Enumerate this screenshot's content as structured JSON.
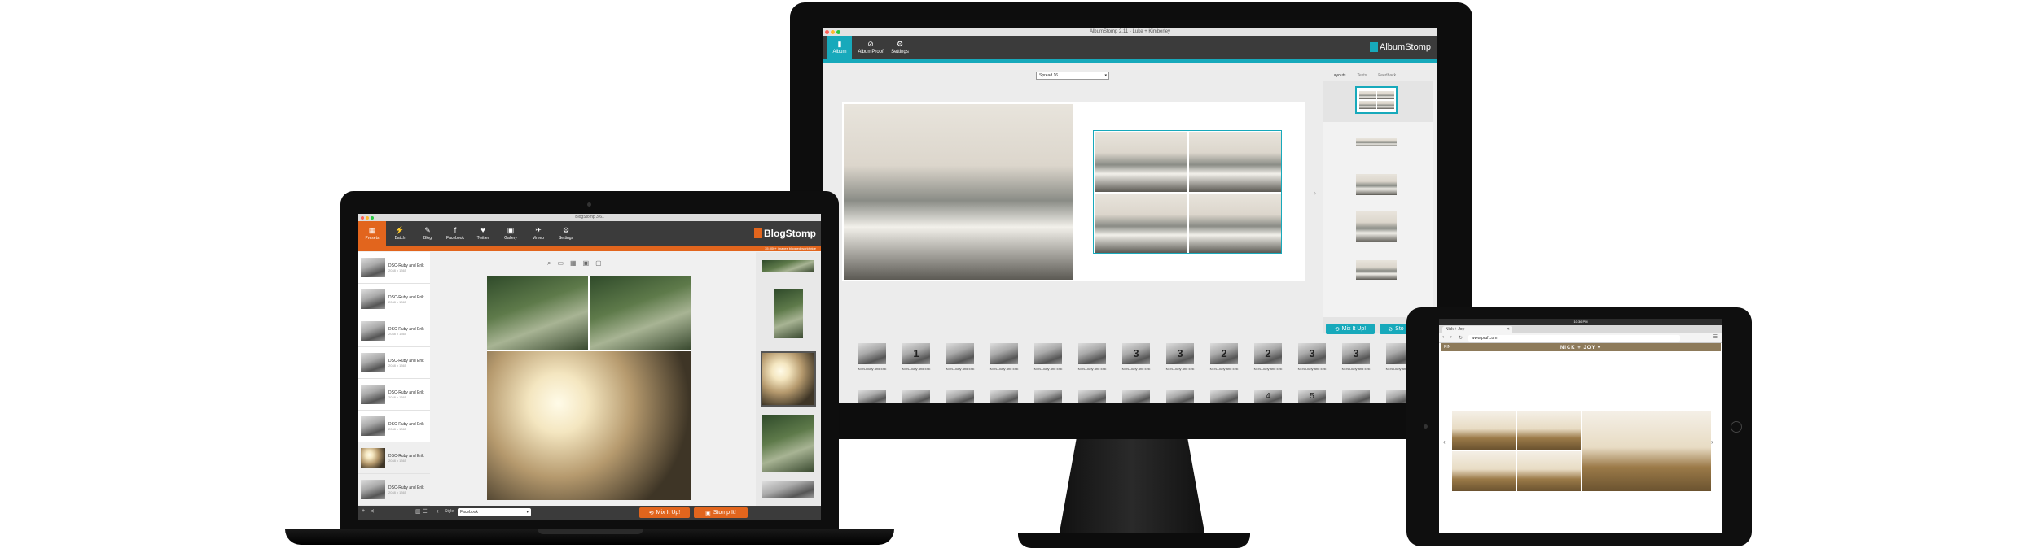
{
  "monitor": {
    "window_title": "AlbumStomp 2.11 - Luke + Kimberley",
    "toolbar": [
      {
        "label": "Album",
        "icon": "album-icon"
      },
      {
        "label": "AlbumProof",
        "icon": "proof-icon"
      },
      {
        "label": "Settings",
        "icon": "gear-icon"
      }
    ],
    "logo_text": "AlbumStomp",
    "spread_select": "Spread 16",
    "tabs": [
      "Layouts",
      "Texts",
      "Feedback"
    ],
    "mix_button": "Mix It Up!",
    "stomp_button": "Sto",
    "filmstrip": [
      {
        "num": "",
        "cap": "KEN-Duby and Erik"
      },
      {
        "num": "1",
        "cap": "KEN-Duby and Erik"
      },
      {
        "num": "",
        "cap": "KEN-Duby and Erik"
      },
      {
        "num": "",
        "cap": "KEN-Duby and Erik"
      },
      {
        "num": "",
        "cap": "KEN-Duby and Erik"
      },
      {
        "num": "",
        "cap": "KEN-Duby and Erik"
      },
      {
        "num": "3",
        "cap": "KEN-Duby and Erik"
      },
      {
        "num": "3",
        "cap": "KEN-Duby and Erik"
      },
      {
        "num": "2",
        "cap": "KEN-Duby and Erik"
      },
      {
        "num": "2",
        "cap": "KEN-Duby and Erik"
      },
      {
        "num": "3",
        "cap": "KEN-Duby and Erik"
      },
      {
        "num": "3",
        "cap": "KEN-Duby and Erik"
      },
      {
        "num": "",
        "cap": "KEN-Duby and Erik"
      }
    ],
    "filmstrip2": [
      "",
      "",
      "",
      "",
      "",
      "",
      "",
      "",
      "",
      "4",
      "5",
      "",
      ""
    ]
  },
  "laptop": {
    "window_title": "BlogStomp 3.61",
    "toolbar": [
      {
        "label": "Presets",
        "icon": "presets-icon"
      },
      {
        "label": "Batch",
        "icon": "batch-icon"
      },
      {
        "label": "Blog",
        "icon": "blog-icon"
      },
      {
        "label": "Facebook",
        "icon": "facebook-icon"
      },
      {
        "label": "Twitter",
        "icon": "twitter-icon"
      },
      {
        "label": "Gallery",
        "icon": "gallery-icon"
      },
      {
        "label": "Vimeo",
        "icon": "vimeo-icon"
      },
      {
        "label": "Settings",
        "icon": "gear-icon"
      }
    ],
    "logo_text": "BlogStomp",
    "promo": "35,000+ images blogged worldwide",
    "list": [
      {
        "t1": "DSC-Ruby and Erik",
        "t2": "2048 x 1365"
      },
      {
        "t1": "DSC-Ruby and Erik",
        "t2": "2048 x 1365"
      },
      {
        "t1": "DSC-Ruby and Erik",
        "t2": "2048 x 1365"
      },
      {
        "t1": "DSC-Ruby and Erik",
        "t2": "2048 x 1365"
      },
      {
        "t1": "DSC-Ruby and Erik",
        "t2": "2048 x 1365"
      },
      {
        "t1": "DSC-Ruby and Erik",
        "t2": "2048 x 1365"
      },
      {
        "t1": "DSC-Ruby and Erik",
        "t2": "2048 x 1365"
      },
      {
        "t1": "DSC-Ruby and Erik",
        "t2": "2048 x 1365"
      }
    ],
    "style_label": "Style",
    "style_value": "Facebook",
    "mix_button": "Mix It Up!",
    "stomp_button": "Stomp It!",
    "bottom_icons": [
      "+",
      "✕"
    ]
  },
  "tablet": {
    "status_time": "10:36 PM",
    "tab_title": "Nick + Joy",
    "url": "www.pruf.com",
    "site_title": "NICK + JOY ▾",
    "menu_text": "PIN"
  },
  "colors": {
    "albumstomp_teal": "#17a9bb",
    "blogstomp_orange": "#e2651d",
    "dark_toolbar": "#3b3b3b"
  }
}
